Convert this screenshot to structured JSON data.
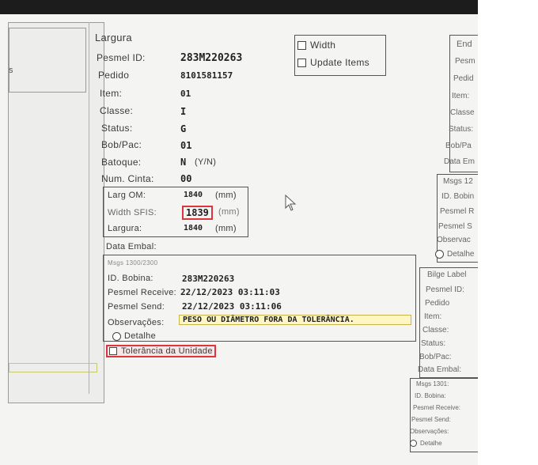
{
  "left": {
    "fragment": "s"
  },
  "main": {
    "largura_header": "Largura",
    "fields": [
      {
        "label": "Pesmel ID:",
        "value": "283M220263"
      },
      {
        "label": "Pedido",
        "value": "8101581157"
      },
      {
        "label": "Item:",
        "value": "01"
      },
      {
        "label": "Classe:",
        "value": "I"
      },
      {
        "label": "Status:",
        "value": "G"
      },
      {
        "label": "Bob/Pac:",
        "value": "01"
      },
      {
        "label": "Batoque:",
        "value": "N"
      },
      {
        "label": "Num. Cinta:",
        "value": "00"
      }
    ],
    "batoque_hint": "(Y/N)",
    "checks": {
      "width": "Width",
      "update": "Update Items"
    },
    "measures": [
      {
        "label": "Larg OM:",
        "value": "1840",
        "unit": "(mm)"
      },
      {
        "label": "Width SFIS:",
        "value": "1839",
        "unit": "(mm)"
      },
      {
        "label": "Largura:",
        "value": "1840",
        "unit": "(mm)"
      }
    ],
    "data_embal": "Data Embal:",
    "msgs": {
      "header": "Msgs 1300/2300",
      "id_bobina_label": "ID. Bobina:",
      "id_bobina": "283M220263",
      "receive_label": "Pesmel Receive:",
      "receive": "22/12/2023 03:11:03",
      "send_label": "Pesmel Send:",
      "send": "22/12/2023 03:11:06",
      "obs_label": "Observações:",
      "obs": "PESO OU DIÂMETRO FORA DA TOLERÂNCIA.",
      "detalhe": "Detalhe"
    },
    "tolerancia": "Tolerância da Unidade"
  },
  "right": {
    "top_labels": [
      "End",
      "Pesm",
      "Pedid",
      "Item:",
      "Classe",
      "Status:",
      "Bob/Pa",
      "Data Em"
    ],
    "msgs_labels": [
      "Msgs 12",
      "ID. Bobin",
      "Pesmel R",
      "Pesmel S",
      "Observac",
      "Detalhe"
    ],
    "bilge_labels": [
      "Bilge Label",
      "Pesmel ID:",
      "Pedido",
      "Item:",
      "Classe:",
      "Status:",
      "Bob/Pac:",
      "Data Embal:"
    ],
    "msgs2_labels": [
      "Msgs 1301:",
      "ID. Bobina:",
      "Pesmel Receive:",
      "Pesmel Send:",
      "Observações:",
      "Detalhe"
    ]
  }
}
